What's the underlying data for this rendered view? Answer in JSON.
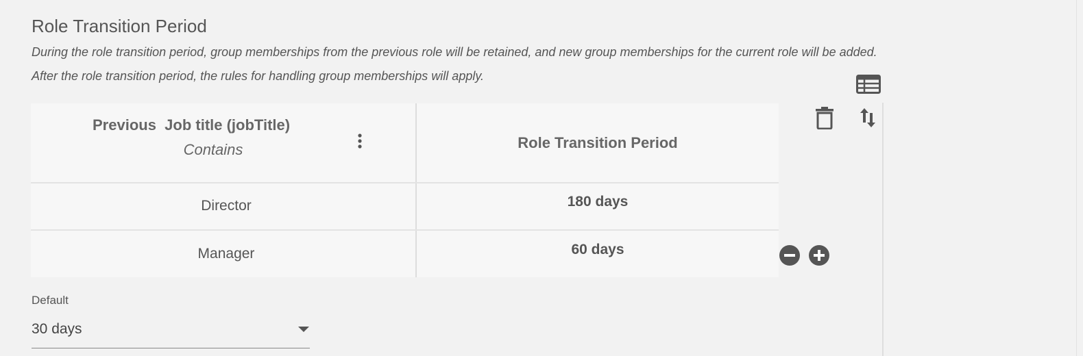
{
  "section": {
    "title": "Role Transition Period",
    "description_line1": "During the role transition period, group memberships from the previous role will be retained, and new group memberships for the current role will be added.",
    "description_line2": "After the role transition period, the rules for handling group memberships will apply."
  },
  "toolbar": {
    "grid_icon": "table-grid-icon",
    "delete_icon": "trash-icon",
    "sort_icon": "sort-arrows-icon"
  },
  "table": {
    "columns": [
      {
        "label": "Previous  Job title (jobTitle)",
        "operator": "Contains",
        "menu_icon": "kebab-menu-icon"
      },
      {
        "label": "Role Transition Period"
      }
    ],
    "rows": [
      {
        "job_title": "Director",
        "period": "180 days"
      },
      {
        "job_title": "Manager",
        "period": "60 days"
      }
    ],
    "row_actions": {
      "remove_icon": "minus-circle-icon",
      "add_icon": "plus-circle-icon"
    }
  },
  "default": {
    "label": "Default",
    "selected": "30 days",
    "dropdown_icon": "caret-down-icon"
  },
  "colors": {
    "background": "#f2f2f2",
    "table_bg": "#f7f7f7",
    "icon": "#555555"
  }
}
